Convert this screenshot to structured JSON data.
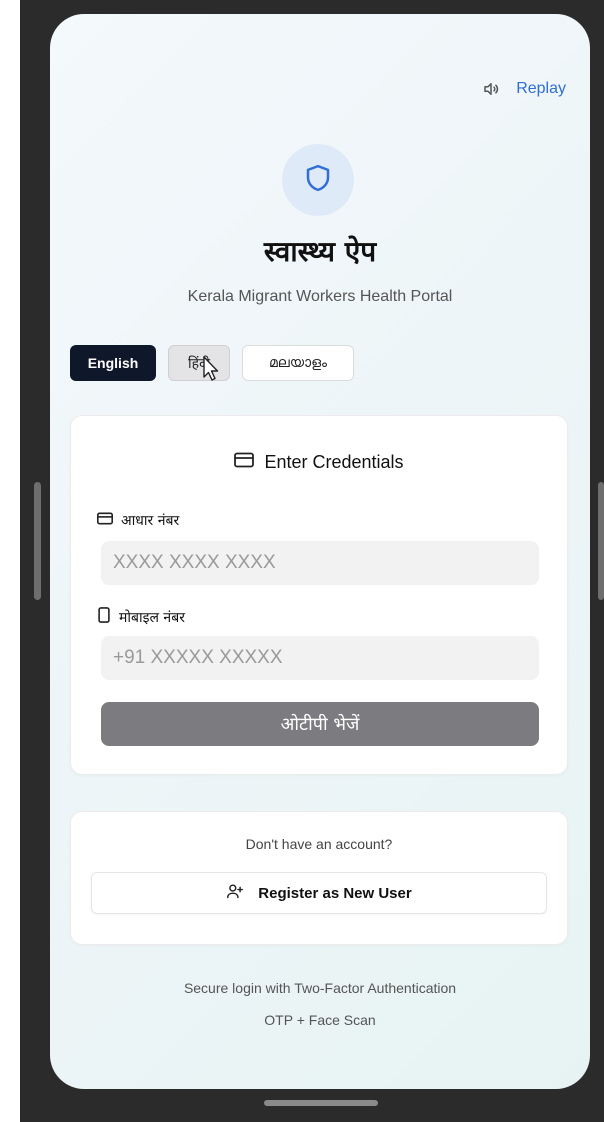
{
  "header": {
    "audio_icon": "speaker-icon",
    "replay_label": "Replay"
  },
  "app": {
    "logo_icon": "shield-icon",
    "title": "स्वास्थ्य ऐप",
    "subtitle": "Kerala Migrant Workers Health Portal"
  },
  "languages": [
    {
      "label": "English",
      "selected": true
    },
    {
      "label": "हिंदी",
      "selected": false
    },
    {
      "label": "മലയാളം",
      "selected": false
    }
  ],
  "login": {
    "header_icon": "id-card-icon",
    "header": "Enter Credentials",
    "aadhaar": {
      "icon": "id-card-icon",
      "label": "आधार नंबर",
      "value": "",
      "placeholder": "XXXX XXXX XXXX"
    },
    "mobile": {
      "icon": "phone-icon",
      "label": "मोबाइल नंबर",
      "value": "",
      "placeholder": "+91 XXXXX XXXXX"
    },
    "send_otp_label": "ओटीपी भेजें"
  },
  "register": {
    "prompt": "Don't have an account?",
    "icon": "user-plus-icon",
    "button_label": "Register as New User"
  },
  "footer": {
    "line1": "Secure login with Two-Factor Authentication",
    "line2": "OTP + Face Scan"
  },
  "colors": {
    "accent": "#2f6fd6",
    "selected_lang": "#0f172a",
    "disabled_button": "#7c7c80"
  }
}
